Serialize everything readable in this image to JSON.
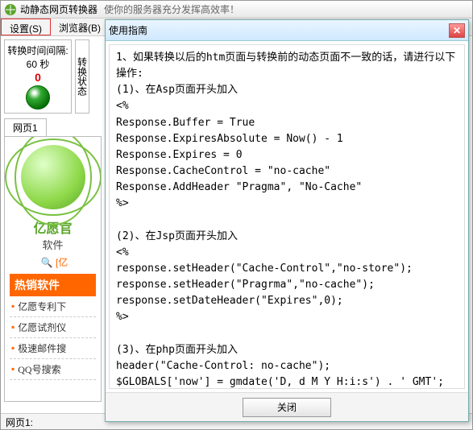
{
  "window": {
    "title": "动静态网页转换器",
    "subtitle": "使你的服务器充分发挥高效率！"
  },
  "menu": {
    "settings": "设置(S)",
    "browser": "浏览器(B)"
  },
  "timer": {
    "label": "转换时间间隔:",
    "seconds": "60 秒",
    "count": "0"
  },
  "status_label": "转换状态",
  "tab": {
    "page1": "网页1"
  },
  "promo": {
    "brand": "亿愿官",
    "slogan": "软件",
    "search": "🔍 [亿",
    "heading": "热销软件",
    "items": [
      "亿愿专利下",
      "亿愿试剂仪",
      "极速邮件搜",
      "QQ号搜索"
    ]
  },
  "statusbar": {
    "label": "网页1:"
  },
  "modal": {
    "title": "使用指南",
    "close_btn": "关闭",
    "body": "1、如果转换以后的htm页面与转换前的动态页面不一致的话，请进行以下操作:\n(1)、在Asp页面开头加入\n<%\nResponse.Buffer = True\nResponse.ExpiresAbsolute = Now() - 1\nResponse.Expires = 0\nResponse.CacheControl = \"no-cache\"\nResponse.AddHeader \"Pragma\", \"No-Cache\"\n%>\n\n(2)、在Jsp页面开头加入\n<%\nresponse.setHeader(\"Cache-Control\",\"no-store\");\nresponse.setHeader(\"Pragrma\",\"no-cache\");\nresponse.setDateHeader(\"Expires\",0);\n%>\n\n(3)、在php页面开头加入\nheader(\"Cache-Control: no-cache\");\n$GLOBALS['now'] = gmdate('D, d M Y H:i:s') . ' GMT';\nheader('Expires: 0'); // rfc2616 - Section 14.21\nheader('Last-Modified: ' . $GLOBALS['now']);\nheader('Cache-Control: no-store, no-cache, must-revalidate, pre-check=0, post-check=0, max-age=0'); // HTTP/1.1\nheader('Pragma: no-cache'); // HTTP/1.0"
  }
}
